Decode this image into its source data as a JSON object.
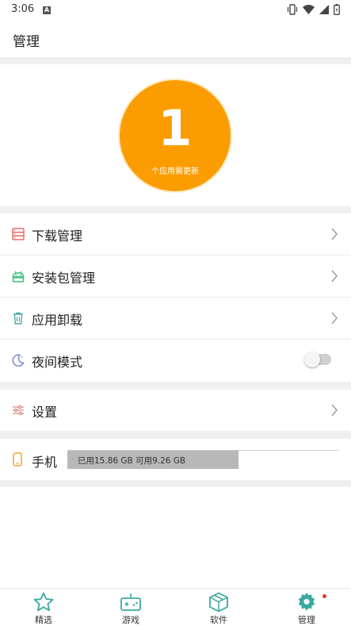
{
  "status_bar": {
    "time": "3:06",
    "notification_letter": "A"
  },
  "header": {
    "title": "管理"
  },
  "updates": {
    "count": "1",
    "caption": "个应用需更新",
    "color": "#fb9d02"
  },
  "menu": {
    "download": {
      "label": "下载管理",
      "icon": "download-list-icon"
    },
    "package": {
      "label": "安装包管理",
      "icon": "android-icon"
    },
    "uninstall": {
      "label": "应用卸载",
      "icon": "trash-icon"
    },
    "night_mode": {
      "label": "夜间模式",
      "icon": "moon-icon",
      "enabled": false
    },
    "settings": {
      "label": "设置",
      "icon": "sliders-icon"
    }
  },
  "storage": {
    "label": "手机",
    "usage_text": "已用15.86 GB  可用9.26 GB",
    "used_fraction": 0.63
  },
  "bottom_nav": {
    "items": [
      {
        "label": "精选",
        "icon": "star-icon",
        "active": false
      },
      {
        "label": "游戏",
        "icon": "gamepad-icon",
        "active": false
      },
      {
        "label": "软件",
        "icon": "box-icon",
        "active": false
      },
      {
        "label": "管理",
        "icon": "gear-icon",
        "active": true,
        "has_badge": true
      }
    ]
  },
  "colors": {
    "accent": "#3aa99f",
    "badge": "#e53935"
  }
}
